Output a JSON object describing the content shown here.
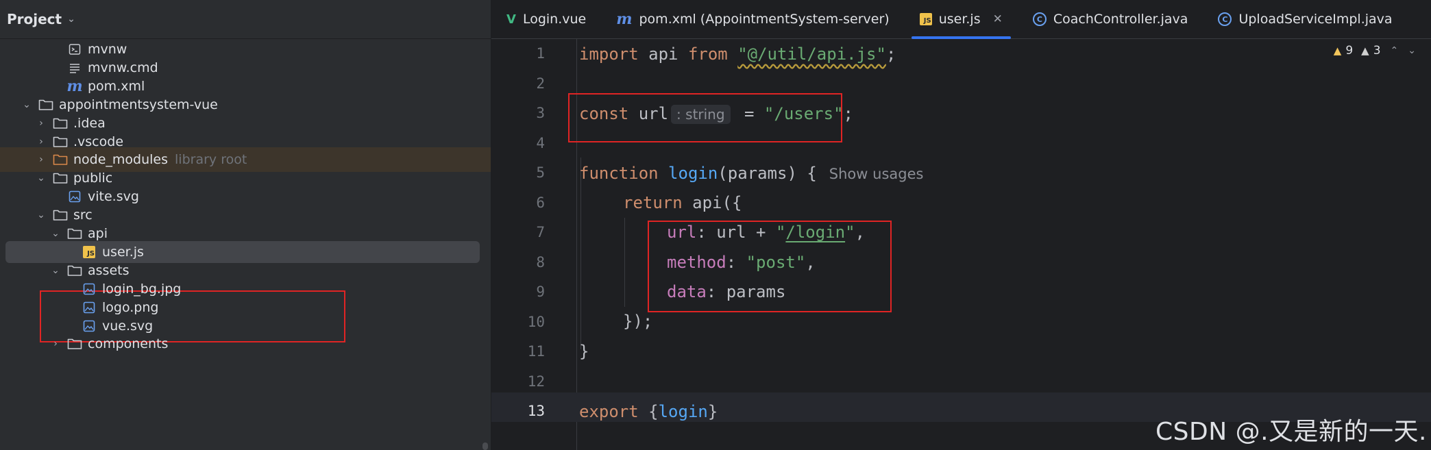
{
  "project_panel": {
    "title": "Project",
    "tree": [
      {
        "label": "mvnw",
        "icon": "terminal-file-icon"
      },
      {
        "label": "mvnw.cmd",
        "icon": "text-file-icon"
      },
      {
        "label": "pom.xml",
        "icon": "maven-icon"
      },
      {
        "label": "appointmentsystem-vue",
        "icon": "folder-icon",
        "expanded": true
      },
      {
        "label": ".idea",
        "icon": "folder-icon",
        "expanded": false
      },
      {
        "label": ".vscode",
        "icon": "folder-icon",
        "expanded": false
      },
      {
        "label": "node_modules",
        "icon": "folder-icon",
        "expanded": false,
        "hint": "library root"
      },
      {
        "label": "public",
        "icon": "folder-icon",
        "expanded": true
      },
      {
        "label": "vite.svg",
        "icon": "image-file-icon"
      },
      {
        "label": "src",
        "icon": "folder-icon",
        "expanded": true
      },
      {
        "label": "api",
        "icon": "folder-icon",
        "expanded": true
      },
      {
        "label": "user.js",
        "icon": "js-file-icon",
        "selected": true
      },
      {
        "label": "assets",
        "icon": "folder-icon",
        "expanded": true
      },
      {
        "label": "login_bg.jpg",
        "icon": "image-file-icon"
      },
      {
        "label": "logo.png",
        "icon": "image-file-icon"
      },
      {
        "label": "vue.svg",
        "icon": "image-file-icon"
      },
      {
        "label": "components",
        "icon": "folder-icon",
        "expanded": false
      }
    ]
  },
  "tabs": [
    {
      "label": "Login.vue",
      "icon": "vue-icon"
    },
    {
      "label": "pom.xml (AppointmentSystem-server)",
      "icon": "maven-icon"
    },
    {
      "label": "user.js",
      "icon": "js-file-icon",
      "active": true
    },
    {
      "label": "CoachController.java",
      "icon": "java-class-icon"
    },
    {
      "label": "UploadServiceImpl.java",
      "icon": "java-class-icon"
    }
  ],
  "tab_close_glyph": "✕",
  "inspections": {
    "warnings": "9",
    "weak_warnings": "3"
  },
  "editor": {
    "line_numbers": [
      "1",
      "2",
      "3",
      "4",
      "5",
      "6",
      "7",
      "8",
      "9",
      "10",
      "11",
      "12",
      "13"
    ],
    "current_line": "13",
    "code": {
      "l1": {
        "kw1": "import",
        "t1": " api ",
        "kw2": "from",
        "t2": " ",
        "str": "\"@/util/api.js\"",
        "t3": ";"
      },
      "l3": {
        "kw": "const",
        "t1": " url",
        "inlay": ": string",
        "t2": " = ",
        "str": "\"/users\"",
        "t3": ";"
      },
      "l5": {
        "kw": "function",
        "t1": " ",
        "fn": "login",
        "t2": "(params) {",
        "usage": "Show usages"
      },
      "l6": {
        "kw": "return",
        "t1": " api({"
      },
      "l7": {
        "prop": "url",
        "t1": ": url + ",
        "str_q1": "\"",
        "str_u": "/login",
        "str_q2": "\"",
        "t2": ","
      },
      "l8": {
        "prop": "method",
        "t1": ": ",
        "str": "\"post\"",
        "t2": ","
      },
      "l9": {
        "prop": "data",
        "t1": ": params"
      },
      "l10": {
        "t": "});"
      },
      "l11": {
        "t": "}"
      },
      "l13": {
        "kw": "export",
        "t1": " {",
        "fn": "login",
        "t2": "}"
      }
    }
  },
  "watermark": "CSDN @.又是新的一天."
}
